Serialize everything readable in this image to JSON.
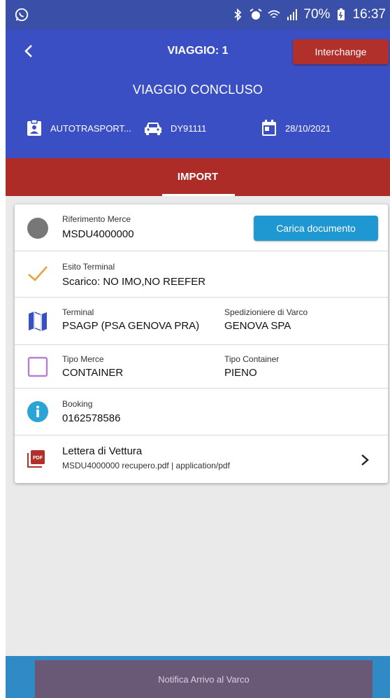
{
  "status_bar": {
    "time": "16:37",
    "battery": "70%",
    "icons": [
      "whatsapp-icon",
      "bluetooth-icon",
      "alarm-icon",
      "wifi-icon",
      "signal-icon",
      "battery-icon"
    ]
  },
  "header": {
    "title": "VIAGGIO: 1",
    "interchange_label": "Interchange",
    "status": "VIAGGIO CONCLUSO",
    "carrier": "AUTOTRASPORT...",
    "plate": "DY91111",
    "date": "28/10/2021"
  },
  "tabs": [
    {
      "label": "IMPORT",
      "selected": true
    }
  ],
  "rows": {
    "riferimento": {
      "label": "Riferimento Merce",
      "value": "MSDU4000000",
      "button": "Carica documento"
    },
    "esito": {
      "label": "Esito Terminal",
      "value": "Scarico: NO IMO,NO REEFER"
    },
    "terminal": {
      "label": "Terminal",
      "value": "PSAGP (PSA GENOVA PRA)",
      "label2": "Spedizioniere di Varco",
      "value2": "GENOVA SPA"
    },
    "tipo": {
      "label": "Tipo Merce",
      "value": "CONTAINER",
      "label2": "Tipo Container",
      "value2": "PIENO"
    },
    "booking": {
      "label": "Booking",
      "value": "0162578586"
    },
    "lettera": {
      "title": "Lettera di Vettura",
      "subtitle": "MSDU4000000 recupero.pdf | application/pdf"
    }
  },
  "footer": {
    "button": "Notifica Arrivo al Varco"
  },
  "colors": {
    "header": "#3a4fc3",
    "tabbar": "#ad2c28",
    "interchange": "#b2302c",
    "carica": "#1f97d1",
    "check": "#e8a33a",
    "tipo_box": "#b37fcf",
    "info_circle": "#2aa3d6",
    "pdf": "#b2302c",
    "footer_button": "#6a5877"
  }
}
